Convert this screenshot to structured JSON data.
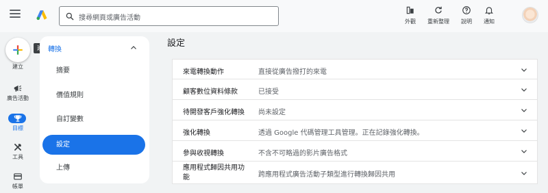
{
  "topbar": {
    "search_placeholder": "搜尋網頁或廣告活動",
    "tools": [
      {
        "label": "外觀",
        "icon": "appearance-icon"
      },
      {
        "label": "重新整理",
        "icon": "refresh-icon"
      },
      {
        "label": "說明",
        "icon": "help-icon"
      },
      {
        "label": "通知",
        "icon": "bell-icon"
      }
    ]
  },
  "rail": {
    "create_label": "建立",
    "tooltip": "建立",
    "items": [
      {
        "label": "廣告活動",
        "icon": "campaign-icon"
      },
      {
        "label": "目標",
        "icon": "trophy-icon",
        "active": true
      },
      {
        "label": "工具",
        "icon": "tools-icon"
      },
      {
        "label": "帳單",
        "icon": "billing-icon"
      }
    ]
  },
  "subnav": {
    "header": "轉換",
    "items": [
      "摘要",
      "價值規則",
      "自訂變數",
      "設定",
      "上傳"
    ],
    "selected": "設定"
  },
  "main": {
    "title": "設定",
    "rows": [
      {
        "name": "來電轉換動作",
        "value": "直接從廣告撥打的來電"
      },
      {
        "name": "顧客數位資料條款",
        "value": "已接受"
      },
      {
        "name": "待開發客戶強化轉換",
        "value": "尚未設定"
      },
      {
        "name": "強化轉換",
        "value": "透過 Google 代碼管理工具管理。正在記錄強化轉換。"
      },
      {
        "name": "參與收視轉換",
        "value": "不含不可略過的影片廣告格式"
      },
      {
        "name": "應用程式歸因共用功能",
        "value": "跨應用程式廣告活動子類型進行轉換歸因共用"
      }
    ]
  },
  "colors": {
    "accent": "#1a73e8",
    "background": "#f1f3f4",
    "panel": "#ffffff"
  }
}
